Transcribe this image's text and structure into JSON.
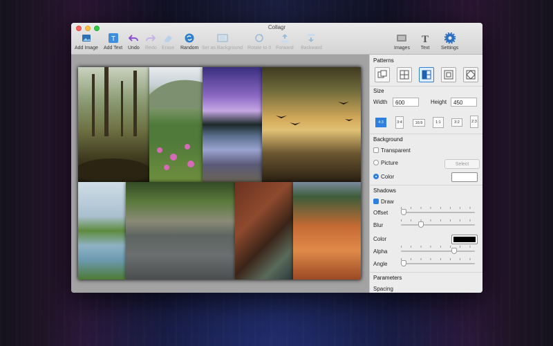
{
  "window": {
    "title": "Collagr"
  },
  "toolbar": {
    "add_image": "Add Image",
    "add_text": "Add Text",
    "undo": "Undo",
    "redo": "Redo",
    "erase": "Erase",
    "random": "Random",
    "set_background": "Set as Background",
    "rotate": "Rotate to 0",
    "forward": "Forward",
    "backward": "Backward",
    "images": "Images",
    "text": "Text",
    "settings": "Settings"
  },
  "panel": {
    "patterns_title": "Patterns",
    "size": {
      "title": "Size",
      "width_label": "Width",
      "width_value": "600",
      "height_label": "Height",
      "height_value": "450"
    },
    "ratios": [
      "4:3",
      "3:4",
      "16:9",
      "1:1",
      "3:2",
      "2:3"
    ],
    "background": {
      "title": "Background",
      "transparent": "Transparent",
      "picture": "Picture",
      "select": "Select",
      "color": "Color",
      "color_value": "#ffffff"
    },
    "shadows": {
      "title": "Shadows",
      "draw": "Draw",
      "offset": "Offset",
      "blur": "Blur",
      "color": "Color",
      "color_value": "#000000",
      "alpha": "Alpha",
      "angle": "Angle",
      "offset_level": 0.02,
      "blur_level": 0.26,
      "alpha_level": 0.72,
      "angle_level": 0.02
    },
    "parameters_title": "Parameters",
    "spacing": "Spacing"
  },
  "colors": {
    "accent": "#2d7fe0"
  }
}
